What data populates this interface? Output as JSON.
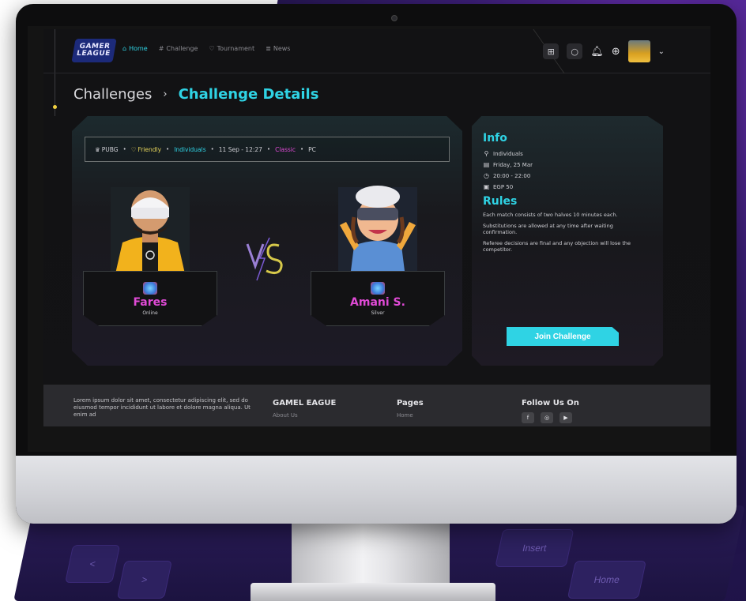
{
  "header": {
    "logo_line1": "GAMER",
    "logo_line2": "LEAGUE",
    "nav": [
      {
        "label": "Home",
        "icon": "home-icon",
        "glyph": "⌂",
        "active": true
      },
      {
        "label": "Challenge",
        "icon": "hash-icon",
        "glyph": "#",
        "active": false
      },
      {
        "label": "Tournament",
        "icon": "trophy-icon",
        "glyph": "♡",
        "active": false
      },
      {
        "label": "News",
        "icon": "news-icon",
        "glyph": "≣",
        "active": false
      }
    ]
  },
  "breadcrumb": {
    "parent": "Challenges",
    "separator": "›",
    "current": "Challenge Details"
  },
  "challenge": {
    "tags": [
      {
        "label": "PUBG",
        "color": "white",
        "icon": "game-icon"
      },
      {
        "label": "Friendly",
        "color": "yellow",
        "icon": "trophy-icon"
      },
      {
        "label": "Individuals",
        "color": "cyan"
      },
      {
        "label": "11 Sep - 12:27",
        "color": "white"
      },
      {
        "label": "Classic",
        "color": "magenta"
      },
      {
        "label": "PC",
        "color": "white"
      }
    ],
    "player1": {
      "name": "Fares",
      "status": "Online"
    },
    "player2": {
      "name": "Amani S.",
      "status": "Silver"
    },
    "vs": "VS"
  },
  "info": {
    "title": "Info",
    "rows": [
      {
        "icon": "user-icon",
        "glyph": "⚲",
        "text": "Individuals"
      },
      {
        "icon": "calendar-icon",
        "glyph": "▤",
        "text": "Friday, 25 Mar"
      },
      {
        "icon": "clock-icon",
        "glyph": "◷",
        "text": "20:00 - 22:00"
      },
      {
        "icon": "money-icon",
        "glyph": "▣",
        "text": "EGP 50"
      }
    ],
    "rules_title": "Rules",
    "rules": [
      "Each match consists of two halves 10 minutes each.",
      "Substitutions are allowed at any time after waiting confirmation.",
      "Referee decisions are final and any objection will lose the competitor."
    ],
    "join_label": "Join Challenge"
  },
  "footer": {
    "about": "Lorem ipsum dolor sit amet, consectetur adipiscing elit, sed do eiusmod tempor incididunt ut labore et dolore magna aliqua. Ut enim ad",
    "col1_title": "GAMEL EAGUE",
    "col1_link": "About Us",
    "col2_title": "Pages",
    "col2_link": "Home",
    "col3_title": "Follow Us On",
    "socials": [
      {
        "icon": "facebook-icon",
        "glyph": "f"
      },
      {
        "icon": "instagram-icon",
        "glyph": "◎"
      },
      {
        "icon": "youtube-icon",
        "glyph": "▶"
      }
    ]
  },
  "keyboard": {
    "keys": [
      {
        "label": "Insert"
      },
      {
        "label": "Home"
      },
      {
        "label": "<"
      },
      {
        "label": ">"
      }
    ]
  },
  "colors": {
    "accent_cyan": "#2fd3e4",
    "accent_magenta": "#e04ad6",
    "accent_yellow": "#e6d55a"
  }
}
